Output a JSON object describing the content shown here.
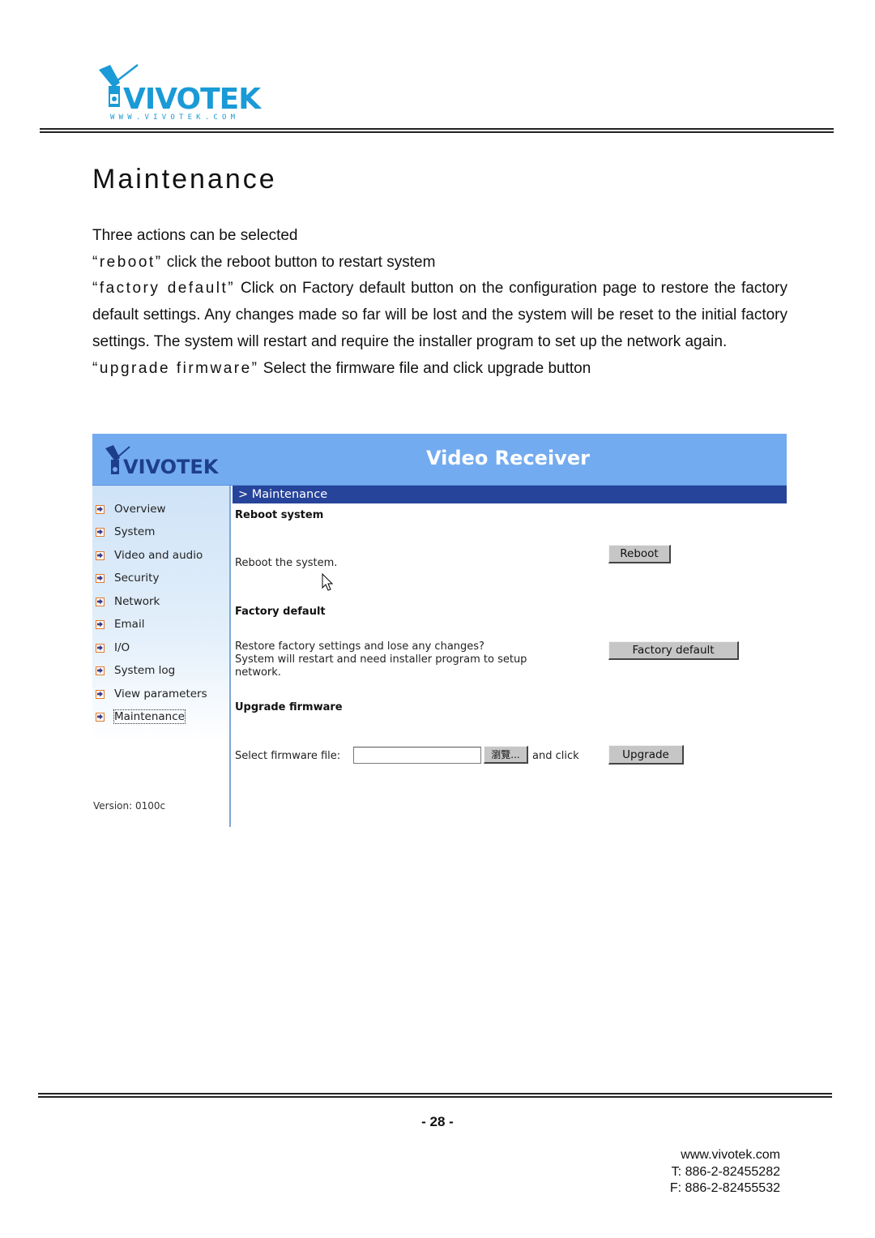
{
  "header": {
    "logo_text": "VIVOTEK",
    "logo_url_text": "WWW.VIVOTEK.COM",
    "brand_color": "#1a9ad6"
  },
  "page": {
    "title": "Maintenance",
    "intro": "Three actions can be selected",
    "items": [
      {
        "keyword": "“reboot”",
        "text": " click the reboot button to restart system"
      },
      {
        "keyword": "“factory default”",
        "text": " Click on Factory default button on the configuration page to restore the factory default settings. Any changes made so far will be lost and the system will be reset to the initial factory settings. The system will restart and require the installer program to set up the network again."
      },
      {
        "keyword": "“upgrade firmware”",
        "text": " Select the firmware file and click upgrade button"
      }
    ]
  },
  "screenshot": {
    "app_title": "Video Receiver",
    "logo_text": "VIVOTEK",
    "breadcrumb": "> Maintenance",
    "header_color": "#73abf0",
    "breadcrumb_color": "#26449a",
    "sidebar": {
      "items": [
        {
          "label": "Overview"
        },
        {
          "label": "System"
        },
        {
          "label": "Video and audio"
        },
        {
          "label": "Security"
        },
        {
          "label": "Network"
        },
        {
          "label": "Email"
        },
        {
          "label": "I/O"
        },
        {
          "label": "System log"
        },
        {
          "label": "View parameters"
        },
        {
          "label": "Maintenance",
          "active": true
        }
      ],
      "version": "Version: 0100c"
    },
    "sections": {
      "reboot": {
        "heading": "Reboot system",
        "description": "Reboot the system.",
        "button": "Reboot"
      },
      "factory": {
        "heading": "Factory default",
        "description_line1": "Restore factory settings and lose any changes?",
        "description_line2": "System will restart and need installer program to setup",
        "description_line3": "network.",
        "button": "Factory default"
      },
      "upgrade": {
        "heading": "Upgrade firmware",
        "file_label": "Select firmware file:",
        "file_value": "",
        "browse_button": "瀏覽...",
        "and_click": "and click",
        "button": "Upgrade"
      }
    }
  },
  "footer": {
    "page_number": "- 28 -",
    "website": "www.vivotek.com",
    "phone": "T: 886-2-82455282",
    "fax": "F: 886-2-82455532"
  }
}
